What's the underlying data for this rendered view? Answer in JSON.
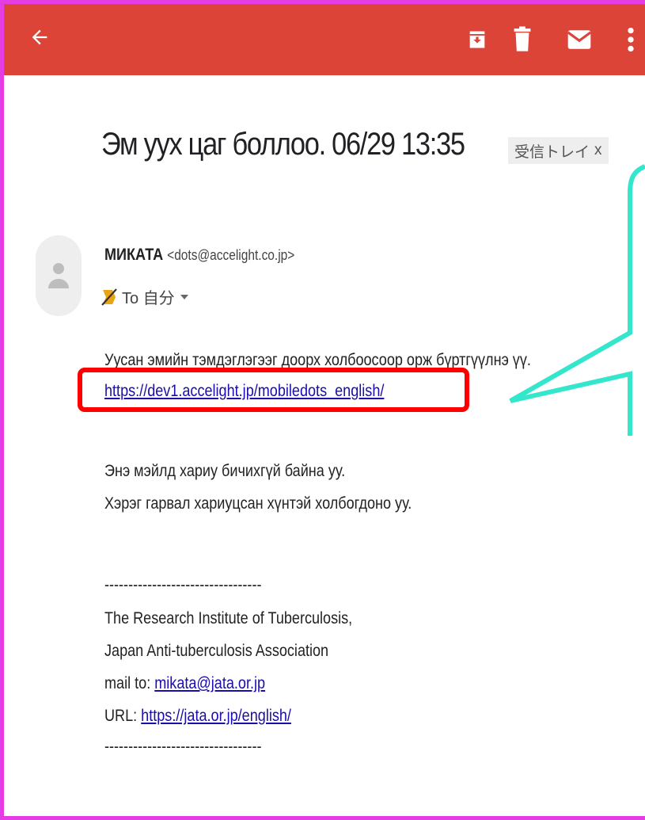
{
  "toolbar": {
    "icons": [
      "back-arrow-icon",
      "archive-icon",
      "delete-icon",
      "mark-unread-icon",
      "more-vert-icon"
    ],
    "color": "#db4437"
  },
  "email": {
    "subject": "Эм уух цаг боллоо. 06/29 13:35",
    "label": "受信トレイ",
    "label_close": "x",
    "sender_name": "МИКАТА",
    "sender_email": "<dots@accelight.co.jp>",
    "to_text": "To 自分",
    "body": {
      "line1": "Уусан эмийн тэмдэглэгээг доорх холбоосоор орж бүртгүүлнэ үү.",
      "link": "https://dev1.accelight.jp/mobiledots_english/",
      "line2": "Энэ мэйлд хариу бичихгүй байна уу.",
      "line3": "Хэрэг гарвал хариуцсан хүнтэй холбогдоно уу.",
      "separator": "---------------------------------",
      "org1": "The Research Institute of Tuberculosis,",
      "org2": "Japan Anti-tuberculosis Association",
      "mail_label": "mail to:",
      "mail_link": "mikata@jata.or.jp",
      "url_label": "URL:",
      "url_link": "https://jata.or.jp/english/",
      "separator2": "---------------------------------"
    }
  },
  "annotations": {
    "highlight_color": "#ff0000",
    "callout_color": "#33e6cc",
    "frame_color": "#e63ce3"
  }
}
